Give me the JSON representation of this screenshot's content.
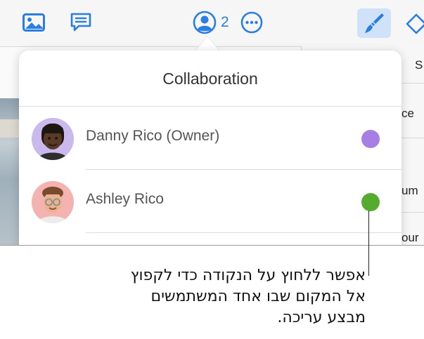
{
  "toolbar": {
    "icons": [
      "media-icon",
      "comment-icon",
      "collaboration-icon",
      "more-icon",
      "format-brush-icon",
      "shape-icon"
    ],
    "collaborator_count": "2"
  },
  "side_panel": {
    "fragments": [
      "S",
      "ce",
      "um",
      "our"
    ]
  },
  "popover": {
    "title": "Collaboration",
    "collaborators": [
      {
        "name": "Danny Rico (Owner)",
        "color": "#a77ee3"
      },
      {
        "name": "Ashley Rico",
        "color": "#55ab2e"
      }
    ]
  },
  "caption": "אפשר ללחוץ על הנקודה כדי לקפוץ אל המקום שבו אחד המשתמשים מבצע עריכה."
}
